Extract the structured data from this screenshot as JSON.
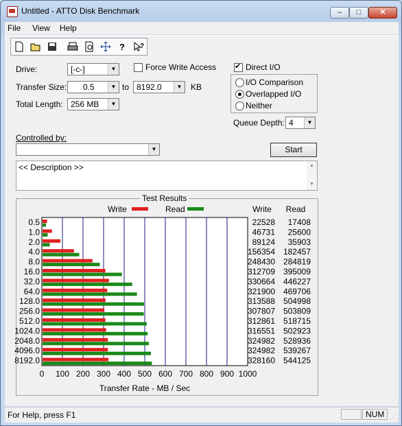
{
  "window": {
    "title": "Untitled - ATTO Disk Benchmark"
  },
  "menu": [
    "File",
    "View",
    "Help"
  ],
  "toolbar": {
    "icons": [
      "new-file-icon",
      "open-folder-icon",
      "save-icon",
      "print-icon",
      "print-preview-icon",
      "move-icon",
      "help-icon",
      "context-help-icon"
    ]
  },
  "settings": {
    "drive_label": "Drive:",
    "drive_value": "[-c-]",
    "force_write_label": "Force Write Access",
    "force_write_checked": false,
    "transfer_size_label": "Transfer Size:",
    "transfer_from": "0.5",
    "to_label": "to",
    "transfer_to": "8192.0",
    "kb_label": "KB",
    "total_length_label": "Total Length:",
    "total_length_value": "256 MB",
    "direct_io_label": "Direct I/O",
    "direct_io_checked": true,
    "io_comparison_label": "I/O Comparison",
    "overlapped_io_label": "Overlapped I/O",
    "neither_label": "Neither",
    "io_mode_selected": "Overlapped I/O",
    "queue_depth_label": "Queue Depth:",
    "queue_depth_value": "4",
    "controlled_by_label": "Controlled by:",
    "controlled_by_value": "",
    "start_label": "Start",
    "description_text": "<< Description >>"
  },
  "results": {
    "title": "Test Results",
    "write_legend": "Write",
    "read_legend": "Read",
    "write_header": "Write",
    "read_header": "Read",
    "xlabel": "Transfer Rate - MB / Sec"
  },
  "colors": {
    "write": "#e02020",
    "read": "#1a8a1a",
    "grid": "#1a1a8a"
  },
  "chart_data": {
    "type": "bar",
    "orientation": "horizontal",
    "title": "Test Results",
    "xlabel": "Transfer Rate - MB / Sec",
    "xlim": [
      0,
      1000
    ],
    "xticks": [
      "0",
      "100",
      "200",
      "300",
      "400",
      "500",
      "600",
      "700",
      "800",
      "900",
      "1000"
    ],
    "categories": [
      "0.5",
      "1.0",
      "2.0",
      "4.0",
      "8.0",
      "16.0",
      "32.0",
      "64.0",
      "128.0",
      "256.0",
      "512.0",
      "1024.0",
      "2048.0",
      "4096.0",
      "8192.0"
    ],
    "series": [
      {
        "name": "Write",
        "values": [
          22.0,
          45.6,
          87.0,
          152.7,
          242.6,
          305.4,
          322.9,
          314.4,
          306.2,
          300.6,
          305.5,
          309.1,
          317.4,
          317.4,
          320.5
        ]
      },
      {
        "name": "Read",
        "values": [
          17.0,
          25.0,
          35.1,
          178.2,
          278.1,
          385.8,
          435.8,
          458.7,
          493.2,
          492.0,
          506.6,
          510.7,
          516.5,
          526.6,
          531.4
        ]
      }
    ],
    "table": {
      "write": [
        "22528",
        "46731",
        "89124",
        "156354",
        "248430",
        "312709",
        "330664",
        "321900",
        "313588",
        "307807",
        "312861",
        "316551",
        "324982",
        "324982",
        "328160"
      ],
      "read": [
        "17408",
        "25600",
        "35903",
        "182457",
        "284819",
        "395009",
        "446227",
        "469706",
        "504998",
        "503809",
        "518715",
        "502923",
        "528936",
        "539267",
        "544125"
      ]
    },
    "legend": "top"
  },
  "status": {
    "help_text": "For Help, press F1",
    "num": "NUM"
  }
}
